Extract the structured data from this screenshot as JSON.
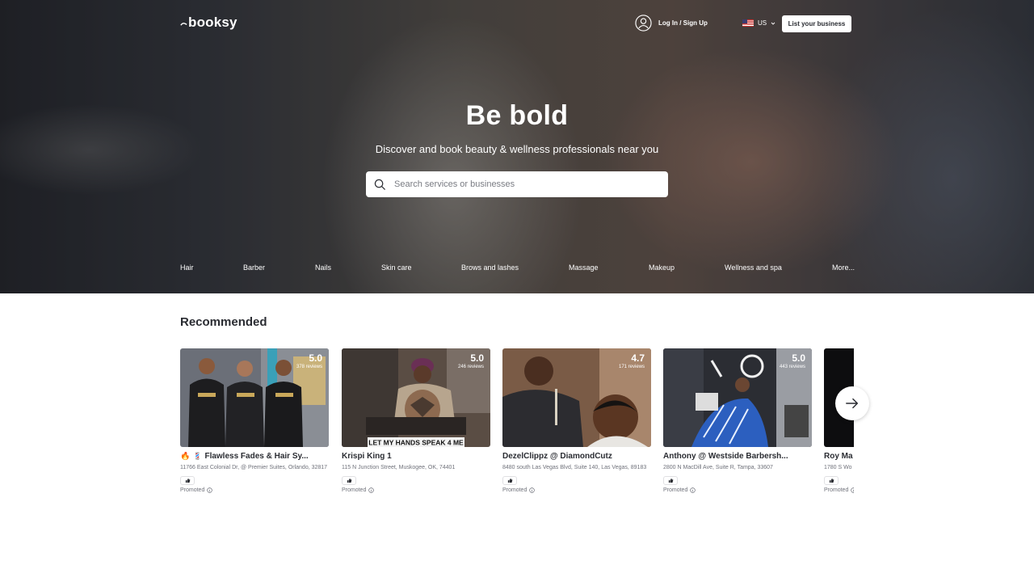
{
  "header": {
    "logo_text": "booksy",
    "login_label": "Log In / Sign Up",
    "locale_label": "US",
    "list_business_label": "List your business"
  },
  "hero": {
    "title": "Be bold",
    "subtitle": "Discover and book beauty & wellness professionals near you",
    "search_placeholder": "Search services or businesses"
  },
  "categories": [
    {
      "label": "Hair"
    },
    {
      "label": "Barber"
    },
    {
      "label": "Nails"
    },
    {
      "label": "Skin care"
    },
    {
      "label": "Brows and lashes"
    },
    {
      "label": "Massage"
    },
    {
      "label": "Makeup"
    },
    {
      "label": "Wellness and spa"
    },
    {
      "label": "More..."
    }
  ],
  "recommended": {
    "title": "Recommended",
    "cards": [
      {
        "name": "🔥 💈 Flawless Fades & Hair Sy...",
        "address": "11766 East Colonial Dr, @ Premier Suites, Orlando, 32817",
        "rating": "5.0",
        "reviews": "378 reviews",
        "promoted": "Promoted"
      },
      {
        "name": "Krispi King 1",
        "address": "115 N Junction Street, Muskogee, OK, 74401",
        "rating": "5.0",
        "reviews": "246 reviews",
        "promoted": "Promoted",
        "thumb_caption": "LET MY HANDS SPEAK 4 ME"
      },
      {
        "name": "DezelClippz @ DiamondCutz",
        "address": "8480 south Las Vegas Blvd, Suite 140, Las Vegas, 89183",
        "rating": "4.7",
        "reviews": "171 reviews",
        "promoted": "Promoted"
      },
      {
        "name": "Anthony @ Westside Barbersh...",
        "address": "2800 N MacDill Ave, Suite R, Tampa, 33607",
        "rating": "5.0",
        "reviews": "443 reviews",
        "promoted": "Promoted"
      },
      {
        "name": "Roy Ma",
        "address": "1780 S Wo",
        "promoted": "Promoted"
      }
    ]
  },
  "colors": {
    "text_dark": "#2a2c32",
    "text_muted": "#6f717a",
    "white": "#ffffff"
  }
}
